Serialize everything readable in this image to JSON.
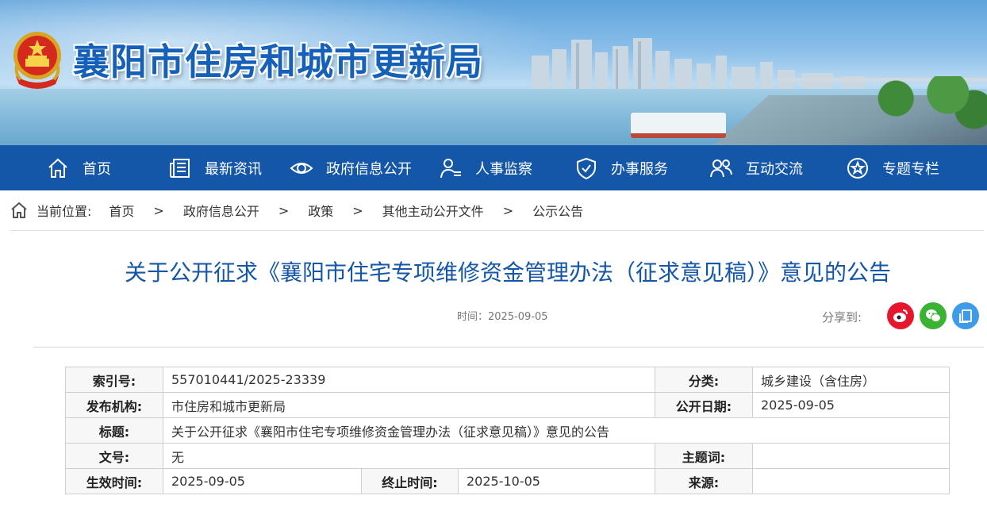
{
  "site": {
    "title": "襄阳市住房和城市更新局"
  },
  "nav": [
    {
      "label": "首页",
      "icon": "home-icon"
    },
    {
      "label": "最新资讯",
      "icon": "newspaper-icon"
    },
    {
      "label": "政府信息公开",
      "icon": "eye-icon"
    },
    {
      "label": "人事监察",
      "icon": "person-icon"
    },
    {
      "label": "办事服务",
      "icon": "shield-check-icon"
    },
    {
      "label": "互动交流",
      "icon": "people-icon"
    },
    {
      "label": "专题专栏",
      "icon": "star-icon"
    }
  ],
  "breadcrumb": {
    "label": "当前位置:",
    "items": [
      "首页",
      "政府信息公开",
      "政策",
      "其他主动公开文件",
      "公示公告"
    ],
    "separator": ">"
  },
  "article": {
    "title": "关于公开征求《襄阳市住宅专项维修资金管理办法（征求意见稿）》意见的公告",
    "time": "时间：2025-09-05",
    "share_label": "分享到:"
  },
  "share": [
    {
      "icon": "weibo-icon",
      "color": "#e6162d"
    },
    {
      "icon": "wechat-icon",
      "color": "#3bb332"
    },
    {
      "icon": "copy-icon",
      "color": "#3d9be9"
    }
  ],
  "info": {
    "index_no_label": "索引号:",
    "index_no": "557010441/2025-23339",
    "category_label": "分类:",
    "category": "城乡建设（含住房）",
    "publisher_label": "发布机构:",
    "publisher": "市住房和城市更新局",
    "open_date_label": "公开日期:",
    "open_date": "2025-09-05",
    "title_label": "标题:",
    "title": "关于公开征求《襄阳市住宅专项维修资金管理办法（征求意见稿）》意见的公告",
    "doc_no_label": "文号:",
    "doc_no": "无",
    "subject_label": "主题词:",
    "subject": "",
    "effective_label": "生效时间:",
    "effective": "2025-09-05",
    "end_label": "终止时间:",
    "end": "2025-10-05",
    "source_label": "来源:",
    "source": ""
  },
  "colors": {
    "nav_bg": "#1456a7",
    "title_blue": "#1456a7"
  }
}
